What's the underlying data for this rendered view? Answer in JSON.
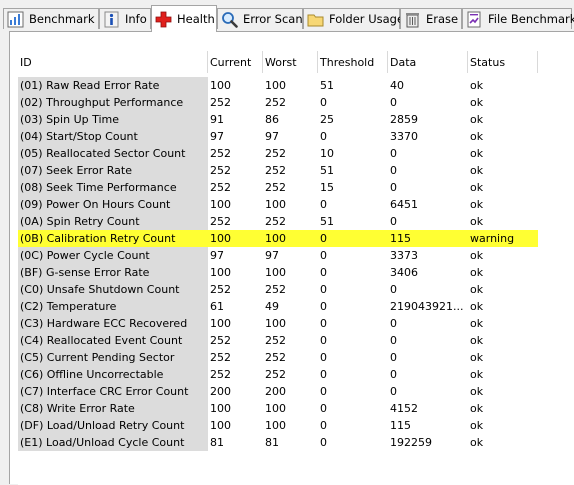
{
  "tabs": [
    {
      "label": "Benchmark",
      "icon": "benchmark-icon"
    },
    {
      "label": "Info",
      "icon": "info-icon"
    },
    {
      "label": "Health",
      "icon": "health-cross-icon",
      "active": true
    },
    {
      "label": "Error Scan",
      "icon": "magnifier-icon"
    },
    {
      "label": "Folder Usage",
      "icon": "folder-icon"
    },
    {
      "label": "Erase",
      "icon": "trash-icon"
    },
    {
      "label": "File Benchmark",
      "icon": "file-benchmark-icon"
    }
  ],
  "table": {
    "columns": [
      "ID",
      "Current",
      "Worst",
      "Threshold",
      "Data",
      "Status"
    ],
    "rows": [
      [
        "(01) Raw Read Error Rate",
        "100",
        "100",
        "51",
        "40",
        "ok"
      ],
      [
        "(02) Throughput Performance",
        "252",
        "252",
        "0",
        "0",
        "ok"
      ],
      [
        "(03) Spin Up Time",
        "91",
        "86",
        "25",
        "2859",
        "ok"
      ],
      [
        "(04) Start/Stop Count",
        "97",
        "97",
        "0",
        "3370",
        "ok"
      ],
      [
        "(05) Reallocated Sector Count",
        "252",
        "252",
        "10",
        "0",
        "ok"
      ],
      [
        "(07) Seek Error Rate",
        "252",
        "252",
        "51",
        "0",
        "ok"
      ],
      [
        "(08) Seek Time Performance",
        "252",
        "252",
        "15",
        "0",
        "ok"
      ],
      [
        "(09) Power On Hours Count",
        "100",
        "100",
        "0",
        "6451",
        "ok"
      ],
      [
        "(0A) Spin Retry Count",
        "252",
        "252",
        "51",
        "0",
        "ok"
      ],
      [
        "(0B) Calibration Retry Count",
        "100",
        "100",
        "0",
        "115",
        "warning"
      ],
      [
        "(0C) Power Cycle Count",
        "97",
        "97",
        "0",
        "3373",
        "ok"
      ],
      [
        "(BF) G-sense Error Rate",
        "100",
        "100",
        "0",
        "3406",
        "ok"
      ],
      [
        "(C0) Unsafe Shutdown Count",
        "252",
        "252",
        "0",
        "0",
        "ok"
      ],
      [
        "(C2) Temperature",
        "61",
        "49",
        "0",
        "219043921...",
        "ok"
      ],
      [
        "(C3) Hardware ECC Recovered",
        "100",
        "100",
        "0",
        "0",
        "ok"
      ],
      [
        "(C4) Reallocated Event Count",
        "252",
        "252",
        "0",
        "0",
        "ok"
      ],
      [
        "(C5) Current Pending Sector",
        "252",
        "252",
        "0",
        "0",
        "ok"
      ],
      [
        "(C6) Offline Uncorrectable",
        "252",
        "252",
        "0",
        "0",
        "ok"
      ],
      [
        "(C7) Interface CRC Error Count",
        "200",
        "200",
        "0",
        "0",
        "ok"
      ],
      [
        "(C8) Write Error Rate",
        "100",
        "100",
        "0",
        "4152",
        "ok"
      ],
      [
        "(DF) Load/Unload Retry Count",
        "100",
        "100",
        "0",
        "115",
        "ok"
      ],
      [
        "(E1) Load/Unload Cycle Count",
        "81",
        "81",
        "0",
        "192259",
        "ok"
      ]
    ]
  },
  "colors": {
    "warning_highlight": "#ffff33",
    "id_column": "#dcdcdc",
    "health_icon": "#e0201c"
  }
}
